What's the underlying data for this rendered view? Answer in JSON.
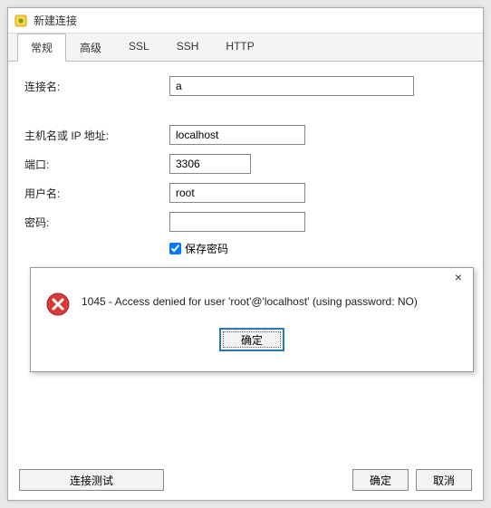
{
  "window": {
    "title": "新建连接"
  },
  "tabs": [
    {
      "label": "常规",
      "active": true
    },
    {
      "label": "高级",
      "active": false
    },
    {
      "label": "SSL",
      "active": false
    },
    {
      "label": "SSH",
      "active": false
    },
    {
      "label": "HTTP",
      "active": false
    }
  ],
  "form": {
    "conn_name_label": "连接名:",
    "conn_name_value": "a",
    "host_label": "主机名或 IP 地址:",
    "host_value": "localhost",
    "port_label": "端口:",
    "port_value": "3306",
    "user_label": "用户名:",
    "user_value": "root",
    "password_label": "密码:",
    "password_value": "",
    "save_password_label": "保存密码",
    "save_password_checked": true
  },
  "buttons": {
    "test": "连接测试",
    "ok": "确定",
    "cancel": "取消"
  },
  "error_dialog": {
    "message": "1045 - Access denied for user 'root'@'localhost' (using password: NO)",
    "ok": "确定",
    "close": "×"
  }
}
